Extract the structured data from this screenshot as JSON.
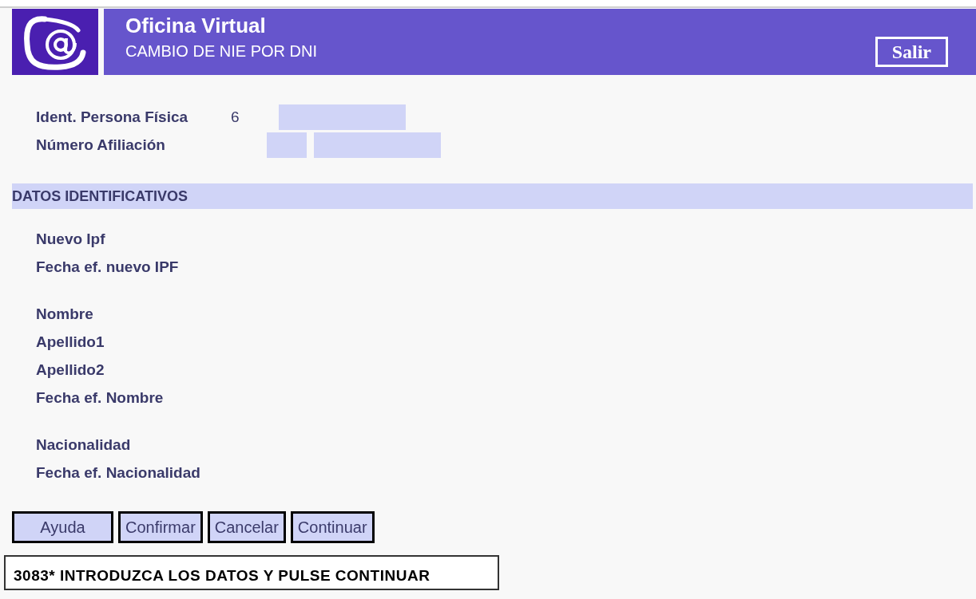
{
  "header": {
    "title": "Oficina Virtual",
    "subtitle": "CAMBIO DE NIE POR DNI",
    "exit_button": "Salir"
  },
  "identification": [
    {
      "label": "Ident. Persona Física",
      "prefix": "6",
      "kind": "single"
    },
    {
      "label": "Número Afiliación",
      "kind": "split"
    }
  ],
  "section": {
    "title": "DATOS IDENTIFICATIVOS"
  },
  "groups": [
    [
      "Nuevo Ipf",
      "Fecha ef. nuevo IPF"
    ],
    [
      "Nombre",
      "Apellido1",
      "Apellido2",
      "Fecha ef. Nombre"
    ],
    [
      "Nacionalidad",
      "Fecha ef. Nacionalidad"
    ]
  ],
  "buttons": [
    "Ayuda",
    "Confirmar",
    "Cancelar",
    "Continuar"
  ],
  "message": "3083* INTRODUZCA LOS DATOS Y PULSE CONTINUAR"
}
